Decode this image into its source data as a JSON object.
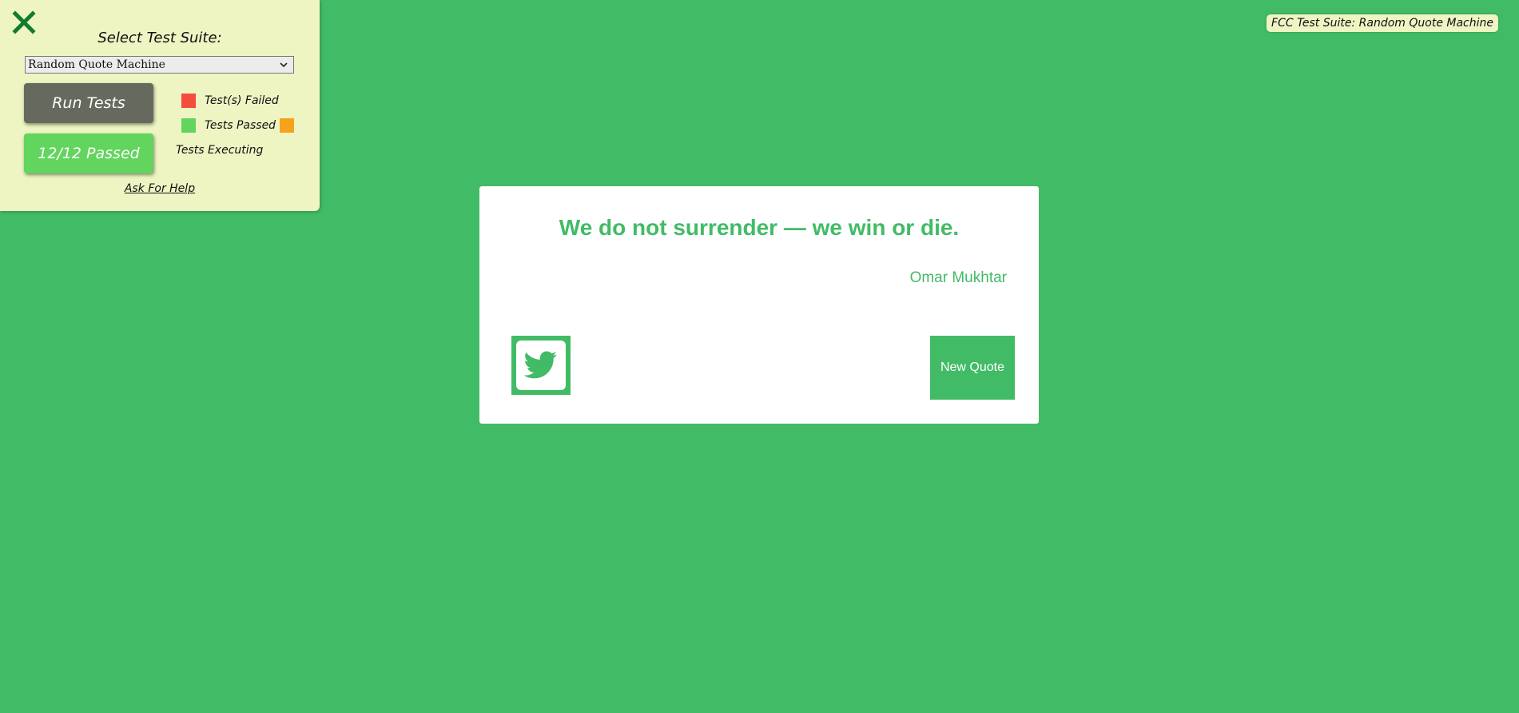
{
  "fcc_panel": {
    "close_icon": "close-icon",
    "suite_title": "Select Test Suite:",
    "suite_selected": "Random Quote Machine",
    "run_tests_label": "Run Tests",
    "passed_label": "12/12 Passed",
    "legend": {
      "failed": {
        "label": "Test(s) Failed",
        "color": "#f44c3d"
      },
      "passed": {
        "label": "Tests Passed",
        "color": "#61d55d"
      },
      "executing": {
        "label": "Tests Executing",
        "color": "#f7a21b"
      }
    },
    "help_label": "Ask For Help"
  },
  "badge": {
    "label": "FCC Test Suite: Random Quote Machine"
  },
  "quote": {
    "text": "We do not surrender — we win or die.",
    "author": "Omar Mukhtar",
    "tweet_icon": "twitter-bird-icon",
    "new_quote_label": "New Quote"
  },
  "colors": {
    "background": "#42bb66",
    "panel": "#eef5c3",
    "run_button": "#666a5e",
    "quote_box": "#ffffff"
  }
}
